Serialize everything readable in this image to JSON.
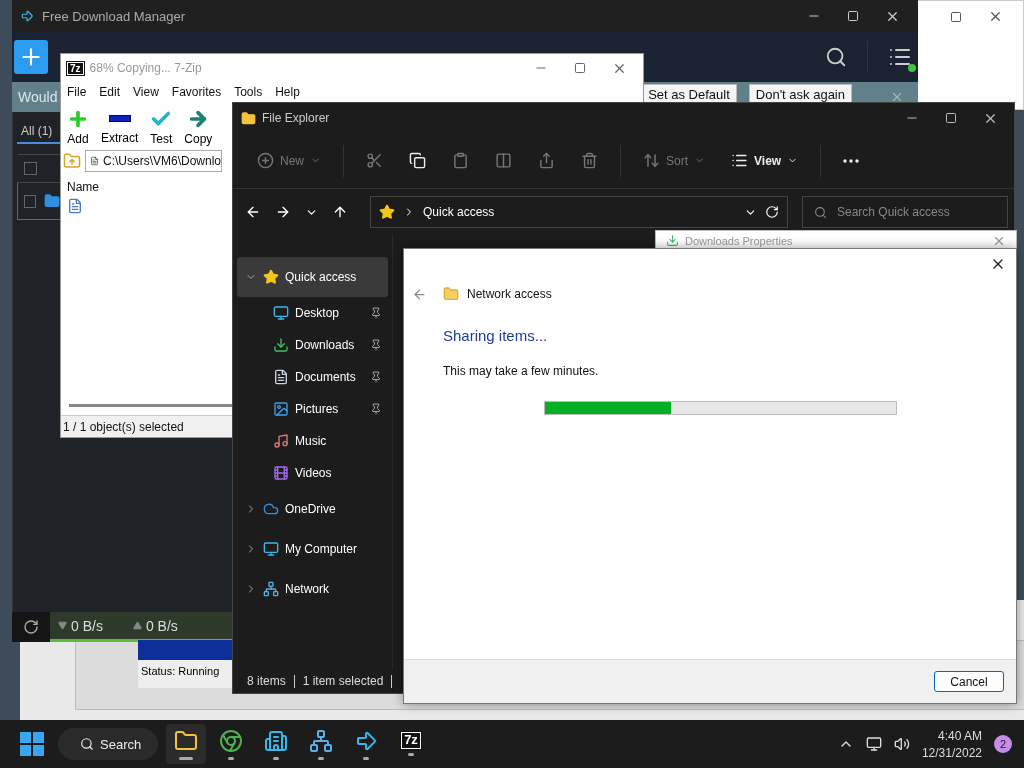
{
  "fdm": {
    "title": "Free Download Manager",
    "banner": {
      "text": "Would",
      "buttons": [
        "Set as Default",
        "Don't ask again"
      ]
    },
    "tabs": [
      {
        "label": "All (1)",
        "selected": true
      }
    ],
    "rows": [
      {
        "checked": false,
        "selected": false
      },
      {
        "checked": false,
        "selected": true
      }
    ],
    "speeds": [
      "0 B/s",
      "0 B/s"
    ]
  },
  "sevenzip": {
    "logo": "7z",
    "title": "68% Copying... 7-Zip",
    "menu": [
      "File",
      "Edit",
      "View",
      "Favorites",
      "Tools",
      "Help"
    ],
    "tools": [
      "Add",
      "Extract",
      "Test",
      "Copy"
    ],
    "path": "C:\\Users\\VM6\\Downlo",
    "column": "Name",
    "status": "1 / 1 object(s) selected"
  },
  "progress_window": {
    "status": "Status: Running"
  },
  "explorer": {
    "title": "File Explorer",
    "commands": [
      {
        "kind": "labeled",
        "label": "New",
        "disabled": true
      },
      {
        "kind": "icon",
        "disabled": true
      },
      {
        "kind": "icon",
        "disabled": false
      },
      {
        "kind": "icon",
        "disabled": true
      },
      {
        "kind": "icon",
        "disabled": true
      },
      {
        "kind": "icon",
        "disabled": true
      },
      {
        "kind": "icon",
        "disabled": true
      },
      {
        "kind": "labeled",
        "label": "Sort",
        "disabled": true
      },
      {
        "kind": "labeled",
        "label": "View",
        "disabled": false
      },
      {
        "kind": "icon",
        "disabled": false
      }
    ],
    "path": "Quick access",
    "search": {
      "placeholder": "Search Quick access"
    },
    "nav": [
      {
        "label": "Quick access",
        "expanded": true,
        "selected": true,
        "children": [
          {
            "label": "Desktop",
            "pinned": true
          },
          {
            "label": "Downloads",
            "pinned": true
          },
          {
            "label": "Documents",
            "pinned": true
          },
          {
            "label": "Pictures",
            "pinned": true
          },
          {
            "label": "Music",
            "pinned": false
          },
          {
            "label": "Videos",
            "pinned": false
          }
        ]
      },
      {
        "label": "OneDrive",
        "expanded": false,
        "selected": false
      },
      {
        "label": "My Computer",
        "expanded": false,
        "selected": false
      },
      {
        "label": "Network",
        "expanded": false,
        "selected": false
      }
    ],
    "status": [
      "8 items",
      "1 item selected"
    ]
  },
  "properties_window": {
    "title": "Downloads Properties"
  },
  "dialog": {
    "title": "Network access",
    "heading": "Sharing items...",
    "message": "This may take a few minutes.",
    "progress": {
      "level": 0.36
    },
    "buttons": [
      "Cancel"
    ]
  },
  "taskbar": {
    "search": "Search",
    "apps": [
      {
        "active": true
      },
      {
        "active": false
      },
      {
        "active": false
      },
      {
        "active": false
      },
      {
        "active": false
      },
      {
        "active": false,
        "logo": "7z"
      }
    ],
    "time": "4:40 AM",
    "date": "12/31/2022",
    "badge": "2"
  }
}
